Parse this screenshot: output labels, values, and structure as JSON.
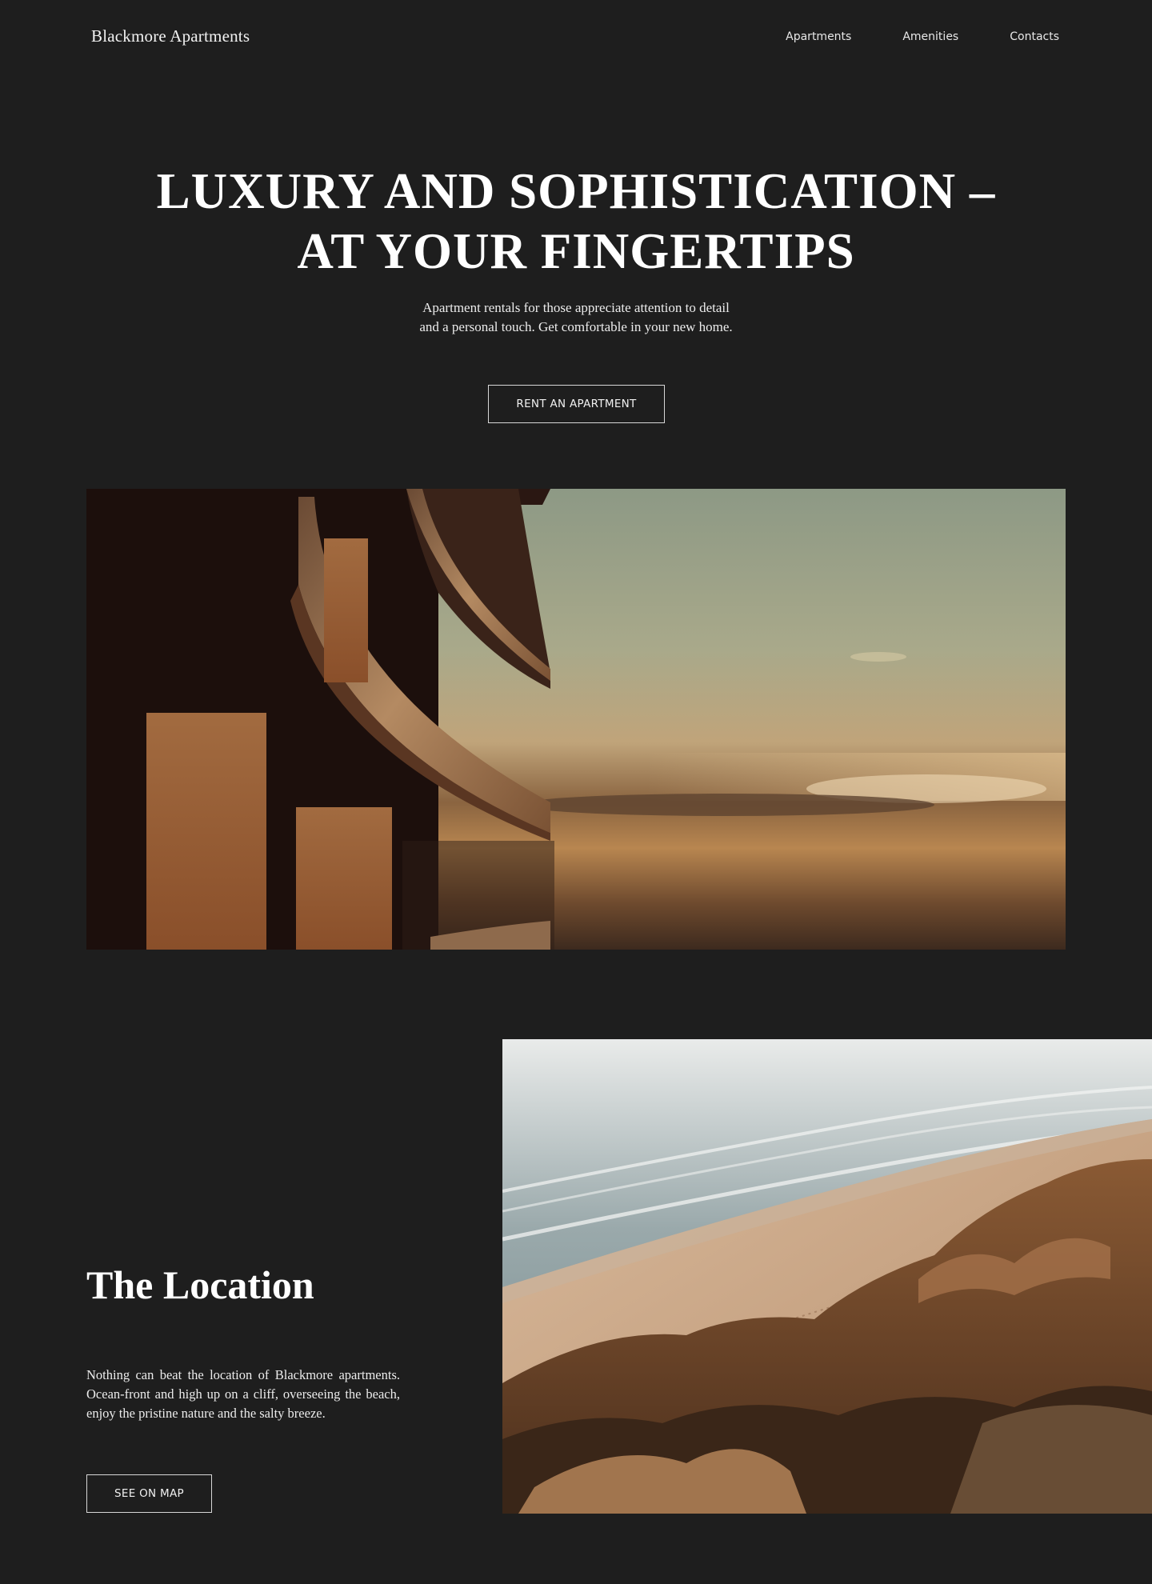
{
  "header": {
    "brand": "Blackmore Apartments",
    "nav": [
      "Apartments",
      "Amenities",
      "Contacts"
    ]
  },
  "hero": {
    "title_line1": "LUXURY AND SOPHISTICATION –",
    "title_line2": "AT YOUR FINGERTIPS",
    "subtitle": "Apartment rentals for those appreciate attention to detail and a personal touch. Get comfortable in your new home.",
    "cta_label": "RENT AN APARTMENT"
  },
  "location": {
    "title": "The Location",
    "text": "Nothing can beat the location of Blackmore apartments. Ocean-front and high up on a cliff, overseeing the beach, enjoy the pristine nature and the salty breeze.",
    "cta_label": "SEE ON MAP"
  },
  "colors": {
    "background": "#1e1e1e",
    "text": "#ffffff",
    "button_border": "#d8d8d8"
  }
}
